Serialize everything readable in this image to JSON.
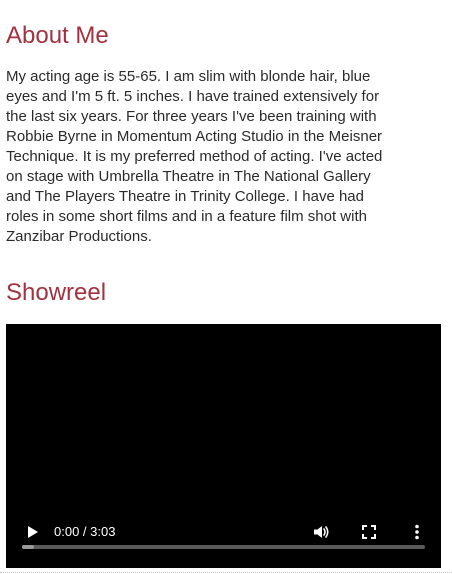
{
  "about": {
    "heading": "About Me",
    "text": "My acting age is 55-65. I am slim with blonde hair, blue\neyes and I'm 5 ft. 5 inches. I have trained extensively for\nthe last six years. For three years I've been training with\nRobbie Byrne in Momentum Acting Studio in the Meisner\nTechnique. It is my preferred method of acting. I've acted\non stage with Umbrella Theatre in The National Gallery\nand The Players Theatre in Trinity College. I have had\nroles in some short films and in a feature film shot with\nZanzibar Productions."
  },
  "showreel": {
    "heading": "Showreel",
    "video": {
      "time_display": "0:00 / 3:03",
      "progress_fraction": 0.0,
      "buffered_fraction": 0.03,
      "icons": {
        "play": "play-icon",
        "volume": "volume-icon",
        "fullscreen": "fullscreen-icon",
        "more": "more-options-icon"
      }
    }
  },
  "colors": {
    "heading": "#a3323f",
    "body_text": "#2b2b2b",
    "video_background": "#000000"
  }
}
